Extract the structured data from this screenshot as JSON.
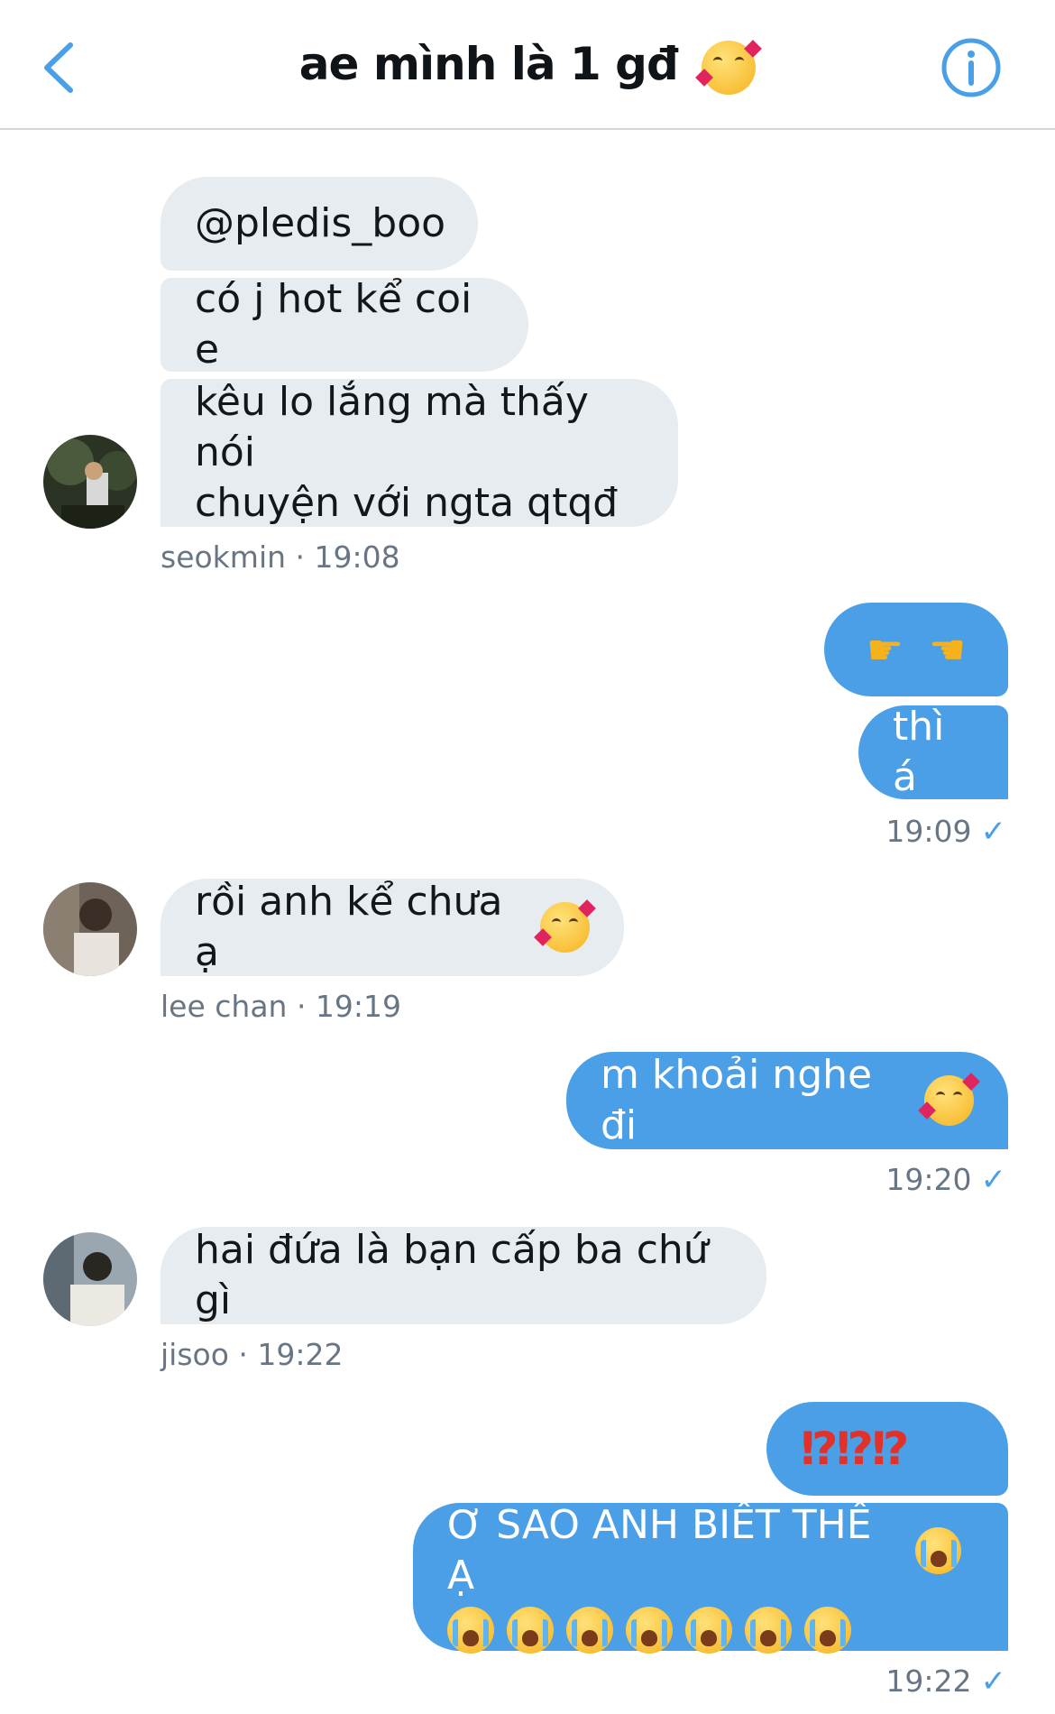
{
  "header": {
    "title": "ae mình là 1 gđ",
    "title_emoji": "smiling-face-with-hearts"
  },
  "messages": [
    {
      "sender": "seokmin",
      "direction": "in",
      "texts": [
        "@pledis_boo",
        "có j hot kể coi e",
        "kêu lo lắng mà thấy nói\nchuyện với ngta qtqđ"
      ],
      "meta": "seokmin · 19:08"
    },
    {
      "direction": "out",
      "texts": [
        "👉👈",
        "thì á"
      ],
      "time": "19:09",
      "status": "✓"
    },
    {
      "sender": "lee chan",
      "direction": "in",
      "texts": [
        "rồi anh kể chưa ạ"
      ],
      "emoji": "smiling-face-with-hearts",
      "meta": "lee chan · 19:19"
    },
    {
      "direction": "out",
      "texts": [
        "m khoải nghe đi"
      ],
      "emoji": "smiling-face-with-hearts",
      "time": "19:20",
      "status": "✓"
    },
    {
      "sender": "jisoo",
      "direction": "in",
      "texts": [
        "hai đứa là bạn cấp ba chứ gì"
      ],
      "meta": "jisoo · 19:22"
    },
    {
      "direction": "out",
      "texts": [
        "⁉⁉⁉",
        "Ơ SAO ANH BIẾT THẾ Ạ"
      ],
      "emoji": "loudly-crying-face",
      "emoji_count": 8,
      "time": "19:22",
      "status": "✓"
    }
  ],
  "colors": {
    "accent": "#4a9fe6",
    "incoming_bubble": "#e6ecf0",
    "meta_text": "#687684"
  },
  "icons": {
    "back": "chevron-left-icon",
    "info": "info-circle-icon"
  }
}
